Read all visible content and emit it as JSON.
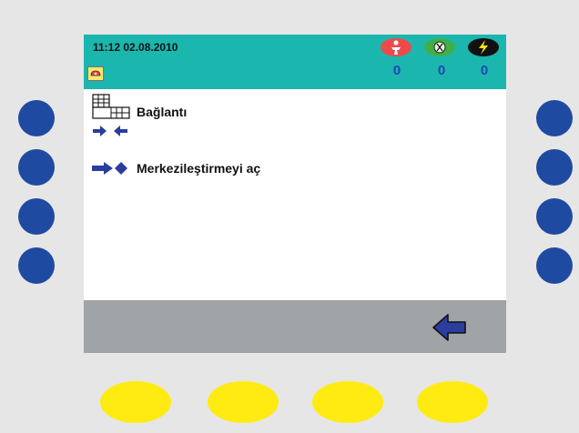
{
  "header": {
    "datetime": "11:12 02.08.2010",
    "status_icons": [
      "patient-icon",
      "sensor-icon",
      "power-icon"
    ],
    "counters": [
      "0",
      "0",
      "0"
    ]
  },
  "menu": {
    "items": [
      {
        "label": "Bağlantı",
        "icon": "connection-icon"
      },
      {
        "label": "Merkezileştirmeyi aç",
        "icon": "centering-icon"
      }
    ]
  },
  "footer": {
    "back_icon": "back-arrow-icon"
  },
  "colors": {
    "header_bg": "#1bb6ae",
    "panel_bg": "#e6e6e6",
    "side_buttons": "#1f4aa2",
    "bottom_buttons": "#ffeb12",
    "footer_bg": "#a0a4a7",
    "counter_text": "#2146b4"
  }
}
